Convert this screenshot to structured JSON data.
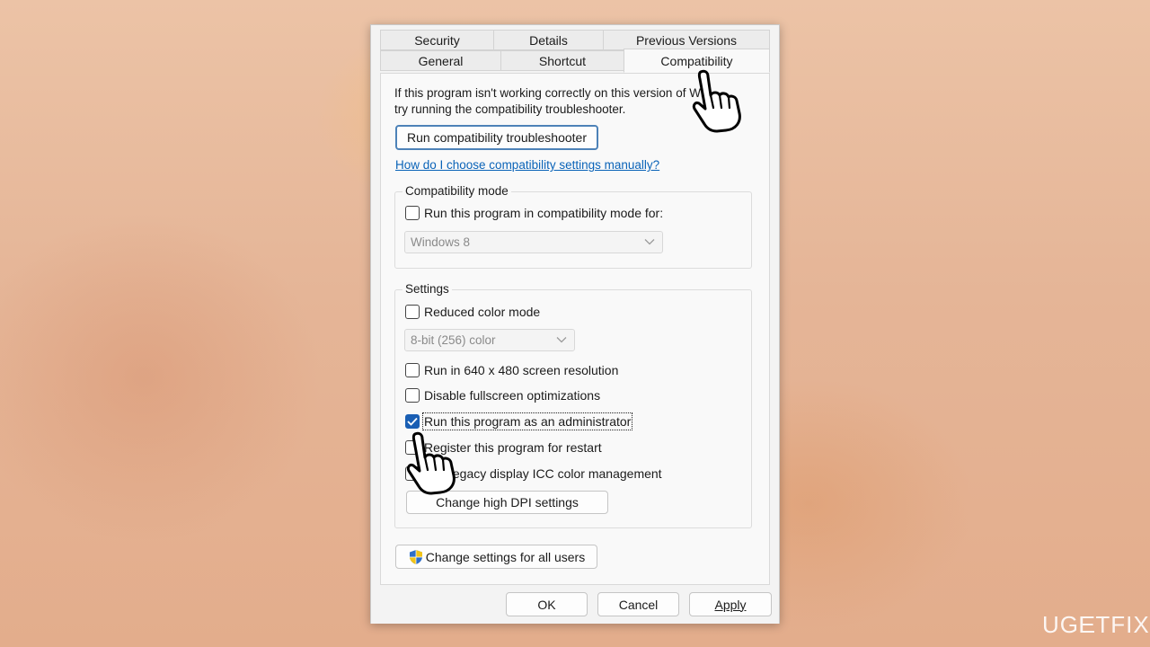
{
  "dialog": {
    "tabs_top": [
      "Security",
      "Details",
      "Previous Versions"
    ],
    "tabs_bottom": [
      "General",
      "Shortcut",
      "Compatibility"
    ],
    "active_tab": "Compatibility",
    "intro_line1": "If this program isn't working correctly on this version of Win",
    "intro_line2": "try running the compatibility troubleshooter.",
    "troubleshooter_button": "Run compatibility troubleshooter",
    "manual_link": "How do I choose compatibility settings manually?",
    "compat_mode": {
      "legend": "Compatibility mode",
      "checkbox_label": "Run this program in compatibility mode for:",
      "checked": false,
      "os_select_value": "Windows 8"
    },
    "settings": {
      "legend": "Settings",
      "reduced_color": {
        "label": "Reduced color mode",
        "checked": false
      },
      "color_select_value": "8-bit (256) color",
      "res_640": {
        "label": "Run in 640 x 480 screen resolution",
        "checked": false
      },
      "disable_fullscreen": {
        "label": "Disable fullscreen optimizations",
        "checked": false
      },
      "run_as_admin": {
        "label": "Run this program as an administrator",
        "checked": true
      },
      "register_restart": {
        "label": "Register this program for restart",
        "checked": false
      },
      "legacy_icc": {
        "label": "Use legacy display ICC color management",
        "checked": false
      },
      "dpi_button": "Change high DPI settings"
    },
    "all_users_button": "Change settings for all users",
    "ok_button": "OK",
    "cancel_button": "Cancel",
    "apply_button": "Apply"
  },
  "watermark": {
    "part1": "UG",
    "part2": "E",
    "part3": "TFIX"
  },
  "colors": {
    "accent": "#1a5fb4",
    "link": "#0a63b8",
    "dialog_bg": "#f3f3f3"
  },
  "icons": [
    "chevron-down-icon",
    "checkmark-icon",
    "uac-shield-icon",
    "hand-pointer-icon"
  ]
}
